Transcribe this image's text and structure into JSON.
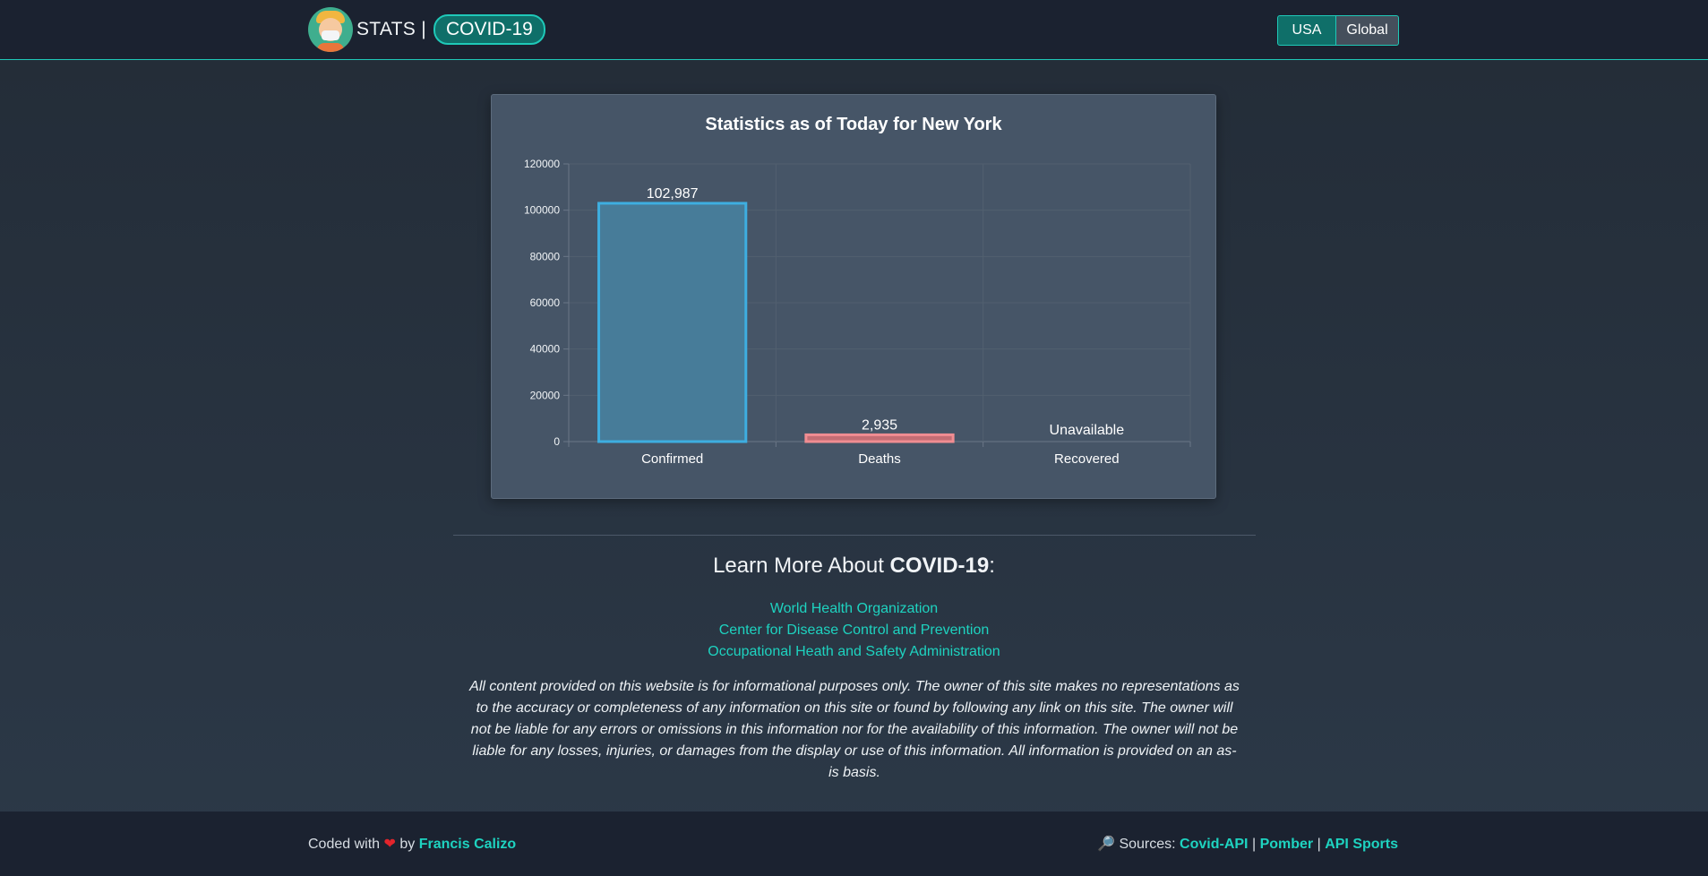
{
  "header": {
    "brand_text": "STATS |",
    "brand_pill": "COVID-19",
    "toggle": {
      "usa": "USA",
      "global": "Global"
    }
  },
  "chart_card": {
    "title": "Statistics as of Today for New York"
  },
  "chart_data": {
    "type": "bar",
    "categories": [
      "Confirmed",
      "Deaths",
      "Recovered"
    ],
    "values": [
      102987,
      2935,
      null
    ],
    "data_labels": [
      "102,987",
      "2,935",
      "Unavailable"
    ],
    "ylim": [
      0,
      120000
    ],
    "yticks": [
      0,
      20000,
      40000,
      60000,
      80000,
      100000,
      120000
    ],
    "ytick_labels": [
      "0",
      "20000",
      "40000",
      "60000",
      "80000",
      "100000",
      "120000"
    ],
    "colors": {
      "Confirmed": {
        "fill": "#477c99",
        "stroke": "#3eaee0"
      },
      "Deaths": {
        "fill": "#c46d74",
        "stroke": "#f08d92"
      }
    },
    "grid": true,
    "legend": "none"
  },
  "learn_more": {
    "prefix": "Learn More About ",
    "bold": "COVID-19",
    "suffix": ":",
    "links": [
      "World Health Organization",
      "Center for Disease Control and Prevention",
      "Occupational Heath and Safety Administration"
    ]
  },
  "disclaimer": "All content provided on this website is for informational purposes only. The owner of this site makes no representations as to the accuracy or completeness of any information on this site or found by following any link on this site. The owner will not be liable for any errors or omissions in this information nor for the availability of this information. The owner will not be liable for any losses, injuries, or damages from the display or use of this information. All information is provided on an as-is basis.",
  "footer": {
    "coded_with": "Coded with",
    "heart": "❤",
    "by": "by",
    "author": "Francis Calizo",
    "search_icon": "🔎",
    "sources_label": "Sources:",
    "sources": [
      "Covid-API",
      "Pomber",
      "API Sports"
    ],
    "separator": "|"
  }
}
